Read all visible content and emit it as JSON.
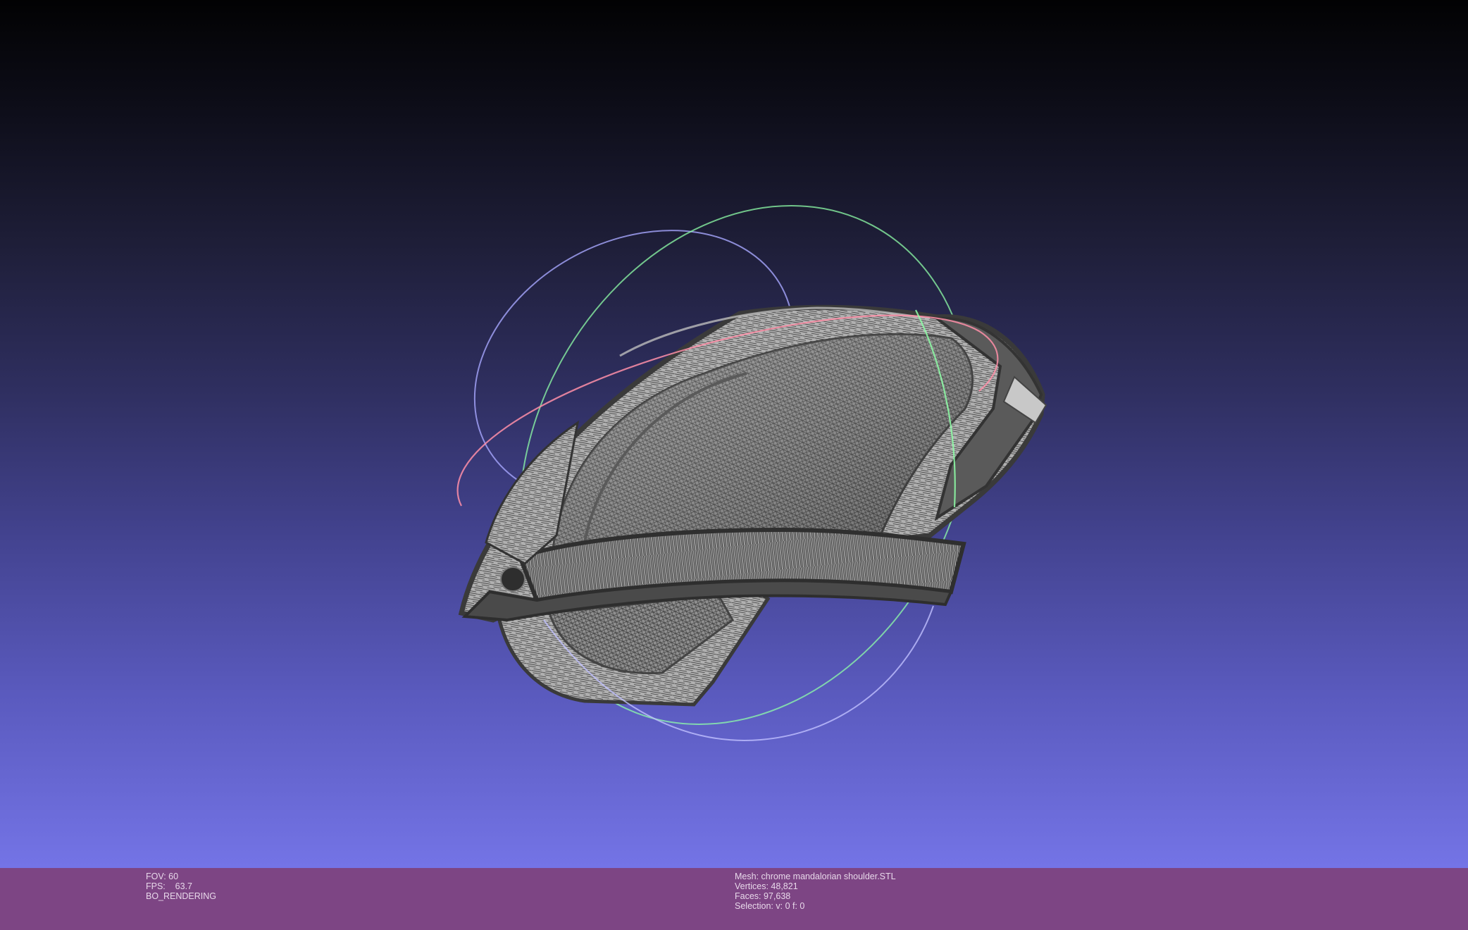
{
  "viewport": {
    "model_name": "chrome mandalorian shoulder.STL",
    "render_mode": "wireframe"
  },
  "status_left": {
    "fov": "FOV: 60",
    "fps": "FPS:    63.7",
    "render_mode": "BO_RENDERING"
  },
  "status_right": {
    "mesh": "Mesh: chrome mandalorian shoulder.STL",
    "vertices": "Vertices: 48,821",
    "faces": "Faces: 97,638",
    "selection": "Selection: v: 0 f: 0"
  },
  "colors": {
    "status_bar": "#7d4584",
    "background_top": "#020203",
    "background_bottom": "#7474e6",
    "mesh": "#9a9a9a",
    "trackball_x": "#ff8fa8",
    "trackball_y": "#8fffa8",
    "trackball_z": "#a8a8ff"
  }
}
